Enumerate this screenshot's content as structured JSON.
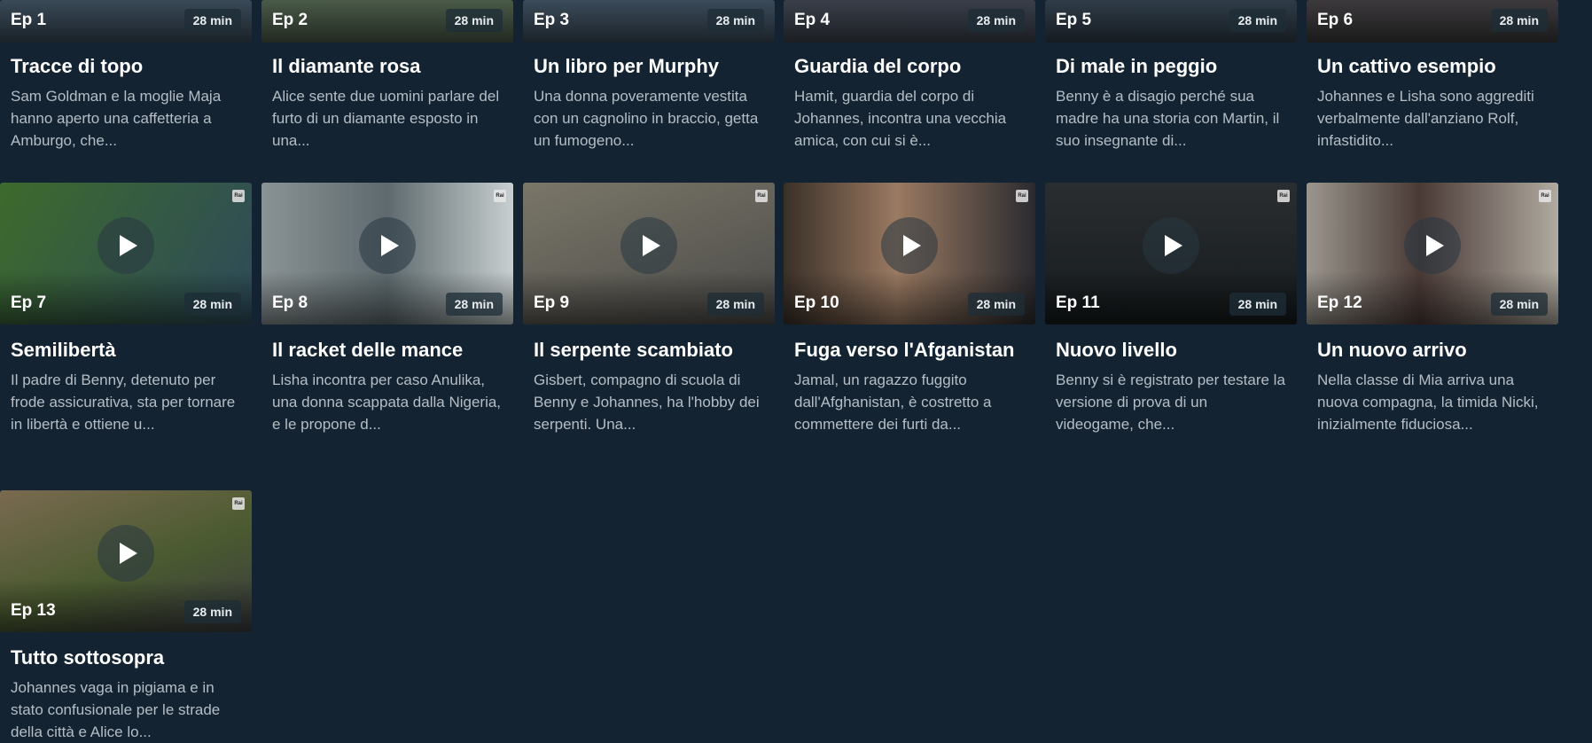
{
  "episodes": [
    {
      "ep": "Ep 1",
      "duration": "28 min",
      "title": "Tracce di topo",
      "desc": "Sam Goldman e la moglie Maja hanno aperto una caffetteria a Amburgo, che...",
      "color": "#3a4a58"
    },
    {
      "ep": "Ep 2",
      "duration": "28 min",
      "title": "Il diamante rosa",
      "desc": "Alice sente due uomini parlare del furto di un diamante esposto in una...",
      "color": "#4a5a48"
    },
    {
      "ep": "Ep 3",
      "duration": "28 min",
      "title": "Un libro per Murphy",
      "desc": "Una donna poveramente vestita con un cagnolino in braccio, getta un fumogeno...",
      "color": "#3b4b5a"
    },
    {
      "ep": "Ep 4",
      "duration": "28 min",
      "title": "Guardia del corpo",
      "desc": "Hamit, guardia del corpo di Johannes, incontra una vecchia amica, con cui si è...",
      "color": "#3a3f4a"
    },
    {
      "ep": "Ep 5",
      "duration": "28 min",
      "title": "Di male in peggio",
      "desc": "Benny è a disagio perché sua madre ha una storia con Martin, il suo insegnante di...",
      "color": "#2f3c48"
    },
    {
      "ep": "Ep 6",
      "duration": "28 min",
      "title": "Un cattivo esempio",
      "desc": "Johannes e Lisha sono aggrediti verbalmente dall'anziano Rolf,  infastidito...",
      "color": "#3c3a3c"
    },
    {
      "ep": "Ep 7",
      "duration": "28 min",
      "title": "Semilibertà",
      "desc": "Il padre di Benny, detenuto per frode assicurativa, sta per tornare in libertà e ottiene u...",
      "color": "#3d6a2c"
    },
    {
      "ep": "Ep 8",
      "duration": "28 min",
      "title": "Il racket delle mance",
      "desc": "Lisha incontra per caso Anulika, una donna scappata dalla Nigeria, e le propone d...",
      "color": "#6e7a7e"
    },
    {
      "ep": "Ep 9",
      "duration": "28 min",
      "title": "Il serpente scambiato",
      "desc": "Gisbert, compagno di scuola di Benny e Johannes, ha l'hobby dei serpenti. Una...",
      "color": "#5e5a52"
    },
    {
      "ep": "Ep 10",
      "duration": "28 min",
      "title": "Fuga verso l'Afganistan",
      "desc": "Jamal, un ragazzo fuggito dall'Afghanistan,  è costretto a commettere dei furti da...",
      "color": "#7a5a4a"
    },
    {
      "ep": "Ep 11",
      "duration": "28 min",
      "title": "Nuovo livello",
      "desc": "Benny si è registrato per testare la versione di prova di un videogame, che...",
      "color": "#23282c"
    },
    {
      "ep": "Ep 12",
      "duration": "28 min",
      "title": "Un nuovo arrivo",
      "desc": "Nella classe di Mia arriva una nuova compagna, la timida Nicki, inizialmente fiduciosa...",
      "color": "#6a6660"
    },
    {
      "ep": "Ep 13",
      "duration": "28 min",
      "title": "Tutto sottosopra",
      "desc": "Johannes vaga in pigiama e in stato confusionale per le strade della città e Alice lo...",
      "color": "#5a6040"
    }
  ]
}
